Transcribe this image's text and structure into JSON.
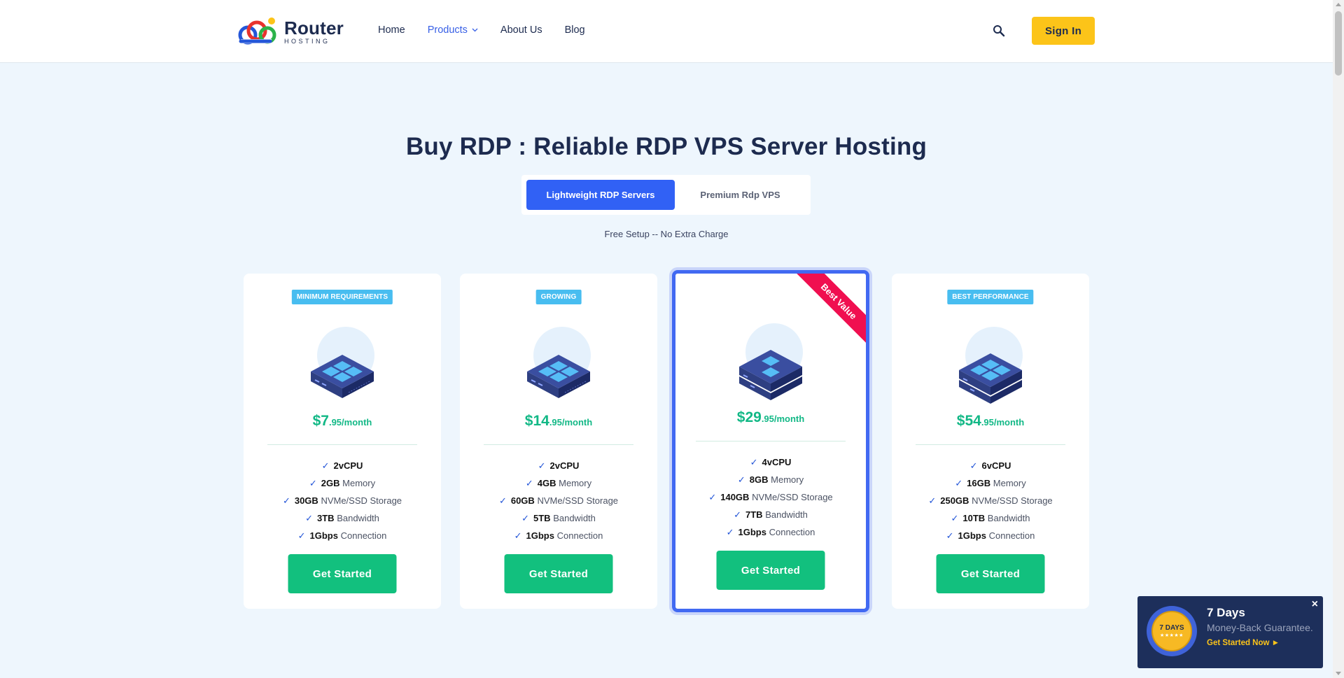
{
  "brand": {
    "name": "Router",
    "tagline": "HOSTING"
  },
  "nav": {
    "items": [
      {
        "label": "Home",
        "active": false
      },
      {
        "label": "Products",
        "active": true,
        "dropdown": true
      },
      {
        "label": "About Us",
        "active": false
      },
      {
        "label": "Blog",
        "active": false
      }
    ],
    "search_icon": "search-icon",
    "sign_in_label": "Sign In"
  },
  "hero": {
    "title": "Buy RDP : Reliable RDP VPS Server Hosting",
    "tabs": [
      {
        "label": "Lightweight RDP Servers",
        "active": true
      },
      {
        "label": "Premium Rdp VPS",
        "active": false
      }
    ],
    "note": "Free Setup -- No Extra Charge"
  },
  "plans": [
    {
      "badge": "MINIMUM REQUIREMENTS",
      "price_main": "$7",
      "price_suffix": ".95/month",
      "ribbon": "",
      "features": [
        {
          "value": "2vCPU",
          "label": ""
        },
        {
          "value": "2GB",
          "label": "Memory"
        },
        {
          "value": "30GB",
          "label": "NVMe/SSD Storage"
        },
        {
          "value": "3TB",
          "label": "Bandwidth"
        },
        {
          "value": "1Gbps",
          "label": "Connection"
        }
      ],
      "cta": "Get Started"
    },
    {
      "badge": "GROWING",
      "price_main": "$14",
      "price_suffix": ".95/month",
      "ribbon": "",
      "features": [
        {
          "value": "2vCPU",
          "label": ""
        },
        {
          "value": "4GB",
          "label": "Memory"
        },
        {
          "value": "60GB",
          "label": "NVMe/SSD Storage"
        },
        {
          "value": "5TB",
          "label": "Bandwidth"
        },
        {
          "value": "1Gbps",
          "label": "Connection"
        }
      ],
      "cta": "Get Started"
    },
    {
      "badge": "",
      "price_main": "$29",
      "price_suffix": ".95/month",
      "ribbon": "Best Value",
      "features": [
        {
          "value": "4vCPU",
          "label": ""
        },
        {
          "value": "8GB",
          "label": "Memory"
        },
        {
          "value": "140GB",
          "label": "NVMe/SSD Storage"
        },
        {
          "value": "7TB",
          "label": "Bandwidth"
        },
        {
          "value": "1Gbps",
          "label": "Connection"
        }
      ],
      "cta": "Get Started"
    },
    {
      "badge": "BEST PERFORMANCE",
      "price_main": "$54",
      "price_suffix": ".95/month",
      "ribbon": "",
      "features": [
        {
          "value": "6vCPU",
          "label": ""
        },
        {
          "value": "16GB",
          "label": "Memory"
        },
        {
          "value": "250GB",
          "label": "NVMe/SSD Storage"
        },
        {
          "value": "10TB",
          "label": "Bandwidth"
        },
        {
          "value": "1Gbps",
          "label": "Connection"
        }
      ],
      "cta": "Get Started"
    }
  ],
  "guarantee": {
    "seal_text": "7 DAYS",
    "seal_stars": "★★★★★",
    "title": "7 Days",
    "subtitle": "Money-Back Guarantee.",
    "link": "Get Started Now ►",
    "close": "×"
  },
  "colors": {
    "accent_blue": "#3161f5",
    "price_green": "#12b886",
    "cta_green": "#12c07e",
    "signin_yellow": "#fcc419",
    "badge_blue": "#48bdf0",
    "ribbon_red": "#f00f50",
    "page_bg": "#eef6fd"
  }
}
